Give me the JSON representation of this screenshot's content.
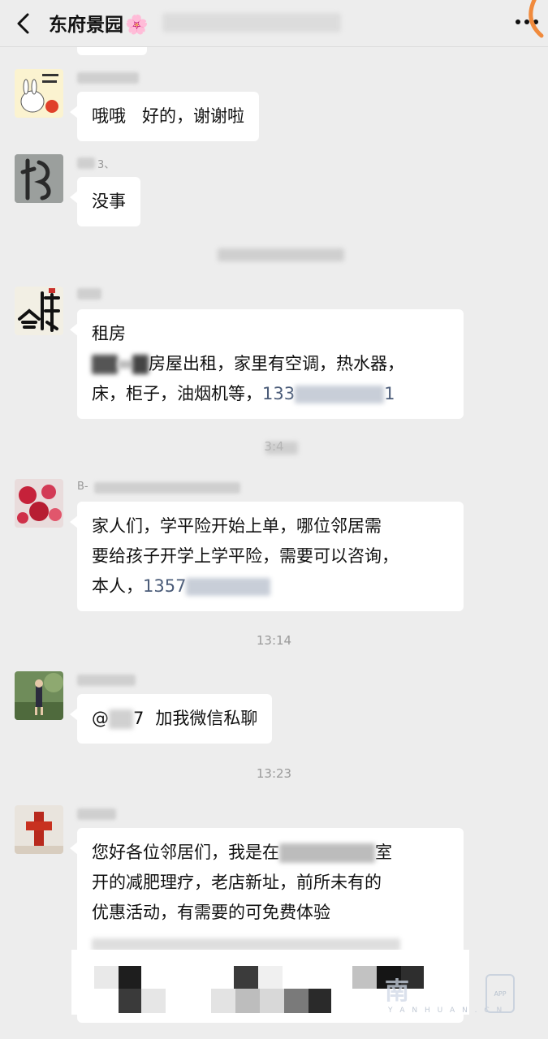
{
  "header": {
    "title": "东府景园",
    "title_emoji": "🌸"
  },
  "messages": [
    {
      "text": "哦哦   好的，谢谢啦"
    },
    {
      "nick_visible": "3、",
      "text": "没事"
    },
    {
      "line1": "租房",
      "line2_mid": "房屋出租，家里有空调，热水器，",
      "line3": "床，柜子，油烟机等，",
      "phone_prefix": "133",
      "phone_suffix": "1"
    },
    {
      "nick_visible": "B-",
      "line1": "家人们，学平险开始上单，哪位邻居需",
      "line2": "要给孩子开学上学平险，需要可以咨询，",
      "line3": "本人，",
      "phone_prefix": "1357"
    },
    {
      "at_prefix": "@",
      "at_suffix": "7",
      "text": "加我微信私聊"
    },
    {
      "line1_prefix": "您好各位邻居们，我是在",
      "line1_suffix": "室",
      "line2": "开的减肥理疗，老店新址，前所未有的",
      "line3": "优惠活动，有需要的可免费体验"
    }
  ],
  "timestamps": {
    "t1": "13:14",
    "t2": "13:23",
    "partial": "3:4"
  },
  "watermark": {
    "main": "南",
    "sub": "Y A N H U A N . C N",
    "app": "APP"
  },
  "colors": {
    "background": "#ededed",
    "bubble": "#ffffff",
    "link_phone": "#4a5b78",
    "timestamp": "#9a9a9a"
  }
}
